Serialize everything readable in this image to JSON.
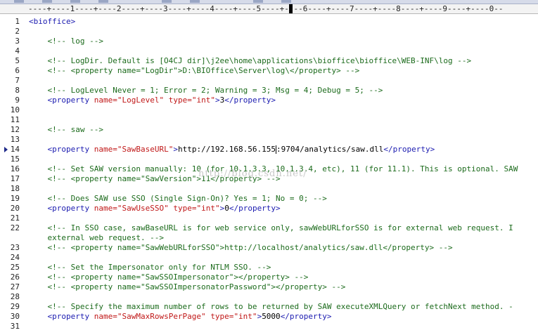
{
  "ruler": {
    "text": "----+----1----+----2----+----3----+----4----+----5----+----6----+----7----+----8----+----9----+----0--"
  },
  "watermark": "http://blog.csdn.net/",
  "lines": [
    {
      "n": "1",
      "parts": [
        {
          "c": "tag",
          "t": "<bioffice>"
        }
      ]
    },
    {
      "n": "2",
      "parts": []
    },
    {
      "n": "3",
      "parts": [
        {
          "c": "cmt",
          "t": "    <!-- log -->"
        }
      ]
    },
    {
      "n": "4",
      "parts": []
    },
    {
      "n": "5",
      "parts": [
        {
          "c": "cmt",
          "t": "    <!-- LogDir. Default is [O4CJ dir]\\j2ee\\home\\applications\\bioffice\\bioffice\\WEB-INF\\log -->"
        }
      ]
    },
    {
      "n": "6",
      "parts": [
        {
          "c": "cmt",
          "t": "    <!-- <property name=\"LogDir\">D:\\BIOffice\\Server\\log\\</property> -->"
        }
      ]
    },
    {
      "n": "7",
      "parts": []
    },
    {
      "n": "8",
      "parts": [
        {
          "c": "cmt",
          "t": "    <!-- LogLevel Never = 1; Error = 2; Warning = 3; Msg = 4; Debug = 5; -->"
        }
      ]
    },
    {
      "n": "9",
      "parts": [
        {
          "c": "tag",
          "t": "    <property "
        },
        {
          "c": "attr",
          "t": "name="
        },
        {
          "c": "attr",
          "t": "\"LogLevel\""
        },
        {
          "c": "tag",
          "t": " "
        },
        {
          "c": "attr",
          "t": "type="
        },
        {
          "c": "attr",
          "t": "\"int\""
        },
        {
          "c": "tag",
          "t": ">"
        },
        {
          "c": "txt",
          "t": "3"
        },
        {
          "c": "tag",
          "t": "</property>"
        }
      ]
    },
    {
      "n": "10",
      "parts": []
    },
    {
      "n": "11",
      "parts": []
    },
    {
      "n": "12",
      "parts": [
        {
          "c": "cmt",
          "t": "    <!-- saw -->"
        }
      ]
    },
    {
      "n": "13",
      "parts": []
    },
    {
      "n": "14",
      "marker": true,
      "parts": [
        {
          "c": "tag",
          "t": "    <property "
        },
        {
          "c": "attr",
          "t": "name="
        },
        {
          "c": "attr",
          "t": "\"SawBaseURL\""
        },
        {
          "c": "tag",
          "t": ">"
        },
        {
          "c": "txt",
          "t": "http://192.168.56.155"
        },
        {
          "c": "cursor",
          "t": ""
        },
        {
          "c": "txt",
          "t": ":9704/analytics/saw.dll"
        },
        {
          "c": "tag",
          "t": "</property>"
        }
      ]
    },
    {
      "n": "15",
      "parts": []
    },
    {
      "n": "16",
      "parts": [
        {
          "c": "cmt",
          "t": "    <!-- Set SAW version manually: 10 (for 10.1.3.3, 10.1.3.4, etc), 11 (for 11.1). This is optional. SAW"
        }
      ]
    },
    {
      "n": "17",
      "parts": [
        {
          "c": "cmt",
          "t": "    <!-- <property name=\"SawVersion\">11</property> -->"
        }
      ]
    },
    {
      "n": "18",
      "parts": []
    },
    {
      "n": "19",
      "parts": [
        {
          "c": "cmt",
          "t": "    <!-- Does SAW use SSO (Single Sign-On)? Yes = 1; No = 0; -->"
        }
      ]
    },
    {
      "n": "20",
      "parts": [
        {
          "c": "tag",
          "t": "    <property "
        },
        {
          "c": "attr",
          "t": "name="
        },
        {
          "c": "attr",
          "t": "\"SawUseSSO\""
        },
        {
          "c": "tag",
          "t": " "
        },
        {
          "c": "attr",
          "t": "type="
        },
        {
          "c": "attr",
          "t": "\"int\""
        },
        {
          "c": "tag",
          "t": ">"
        },
        {
          "c": "txt",
          "t": "0"
        },
        {
          "c": "tag",
          "t": "</property>"
        }
      ]
    },
    {
      "n": "21",
      "parts": []
    },
    {
      "n": "22",
      "parts": [
        {
          "c": "cmt",
          "t": "    <!-- In SSO case, sawBaseURL is for web service only, sawWebURLforSSO is for external web request. I"
        }
      ]
    },
    {
      "n": "",
      "parts": [
        {
          "c": "cmt",
          "t": "    external web request. -->"
        }
      ]
    },
    {
      "n": "23",
      "parts": [
        {
          "c": "cmt",
          "t": "    <!-- <property name=\"SawWebURLforSSO\">http://localhost/analytics/saw.dll</property> -->"
        }
      ]
    },
    {
      "n": "24",
      "parts": []
    },
    {
      "n": "25",
      "parts": [
        {
          "c": "cmt",
          "t": "    <!-- Set the Impersonator only for NTLM SSO. -->"
        }
      ]
    },
    {
      "n": "26",
      "parts": [
        {
          "c": "cmt",
          "t": "    <!-- <property name=\"SawSSOImpersonator\"></property> -->"
        }
      ]
    },
    {
      "n": "27",
      "parts": [
        {
          "c": "cmt",
          "t": "    <!-- <property name=\"SawSSOImpersonatorPassword\"></property> -->"
        }
      ]
    },
    {
      "n": "28",
      "parts": []
    },
    {
      "n": "29",
      "parts": [
        {
          "c": "cmt",
          "t": "    <!-- Specify the maximum number of rows to be returned by SAW executeXMLQuery or fetchNext method. -"
        }
      ]
    },
    {
      "n": "30",
      "parts": [
        {
          "c": "tag",
          "t": "    <property "
        },
        {
          "c": "attr",
          "t": "name="
        },
        {
          "c": "attr",
          "t": "\"SawMaxRowsPerPage\""
        },
        {
          "c": "tag",
          "t": " "
        },
        {
          "c": "attr",
          "t": "type="
        },
        {
          "c": "attr",
          "t": "\"int\""
        },
        {
          "c": "tag",
          "t": ">"
        },
        {
          "c": "txt",
          "t": "5000"
        },
        {
          "c": "tag",
          "t": "</property>"
        }
      ]
    },
    {
      "n": "31",
      "parts": []
    }
  ]
}
